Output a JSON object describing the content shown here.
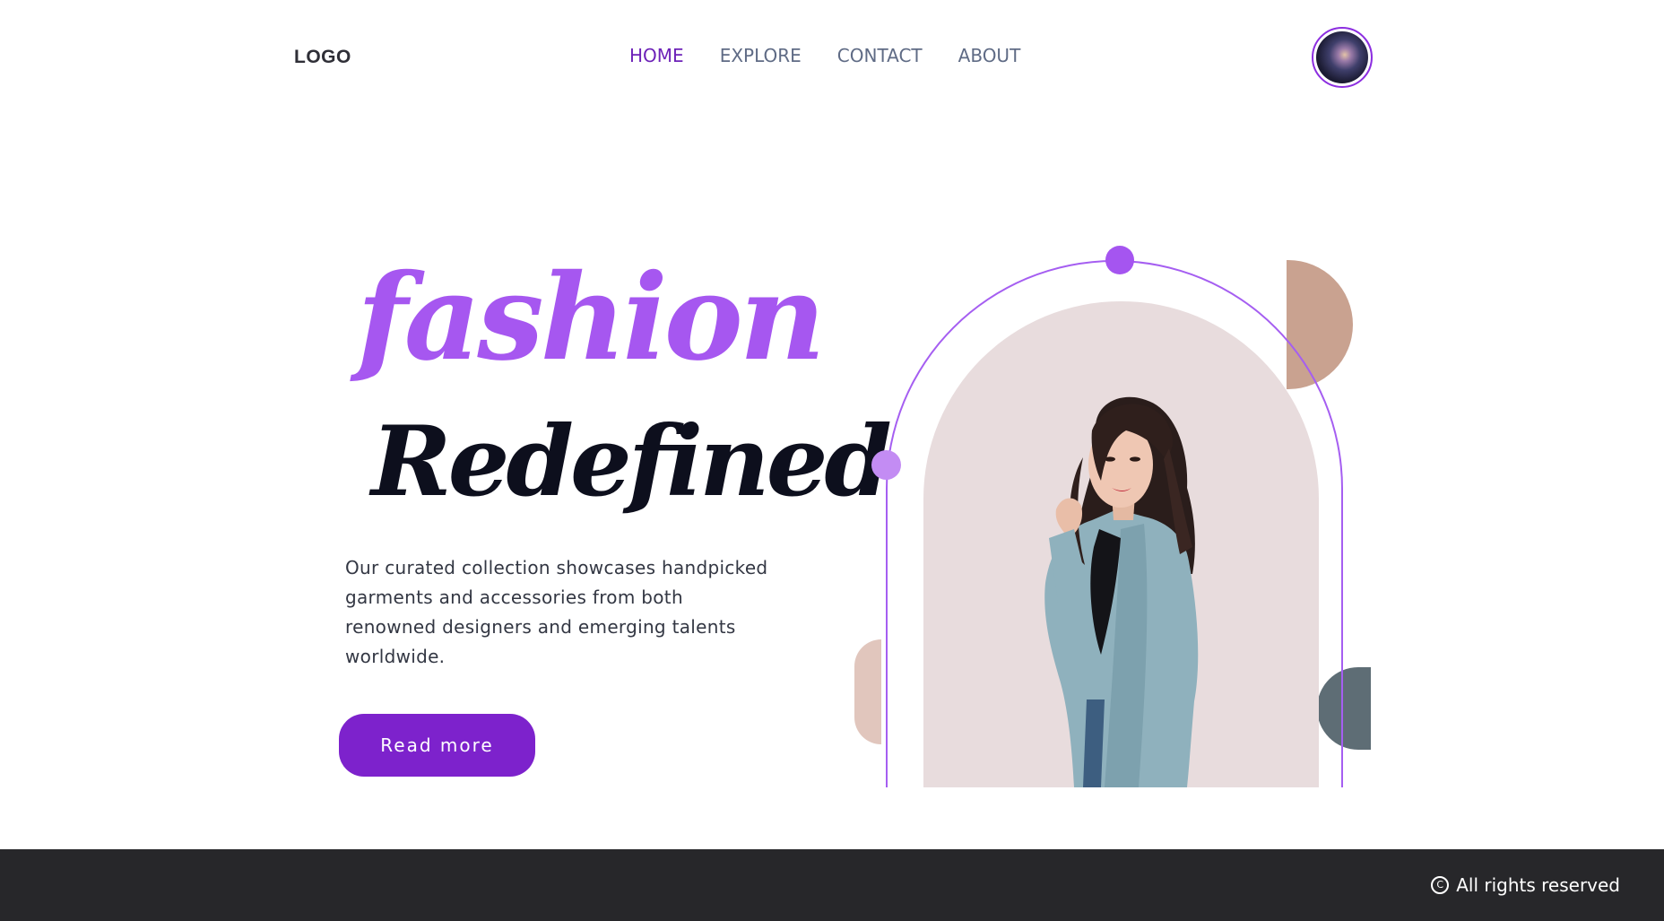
{
  "header": {
    "logo": "LOGO",
    "nav": [
      {
        "label": "HOME",
        "active": true
      },
      {
        "label": "EXPLORE",
        "active": false
      },
      {
        "label": "CONTACT",
        "active": false
      },
      {
        "label": "ABOUT",
        "active": false
      }
    ]
  },
  "hero": {
    "title_line1": "fashion",
    "title_line2": "Redefined",
    "description": "Our curated collection showcases handpicked garments and accessories from both renowned designers and emerging talents worldwide.",
    "cta_label": "Read more"
  },
  "footer": {
    "icon": "copyright-icon",
    "text": "All rights reserved"
  },
  "colors": {
    "accent": "#7d22cc",
    "nav_active": "#6d22b8",
    "title_primary": "#a657f0",
    "arch_background": "#e8dcdd",
    "footer_bg": "#27272a"
  }
}
